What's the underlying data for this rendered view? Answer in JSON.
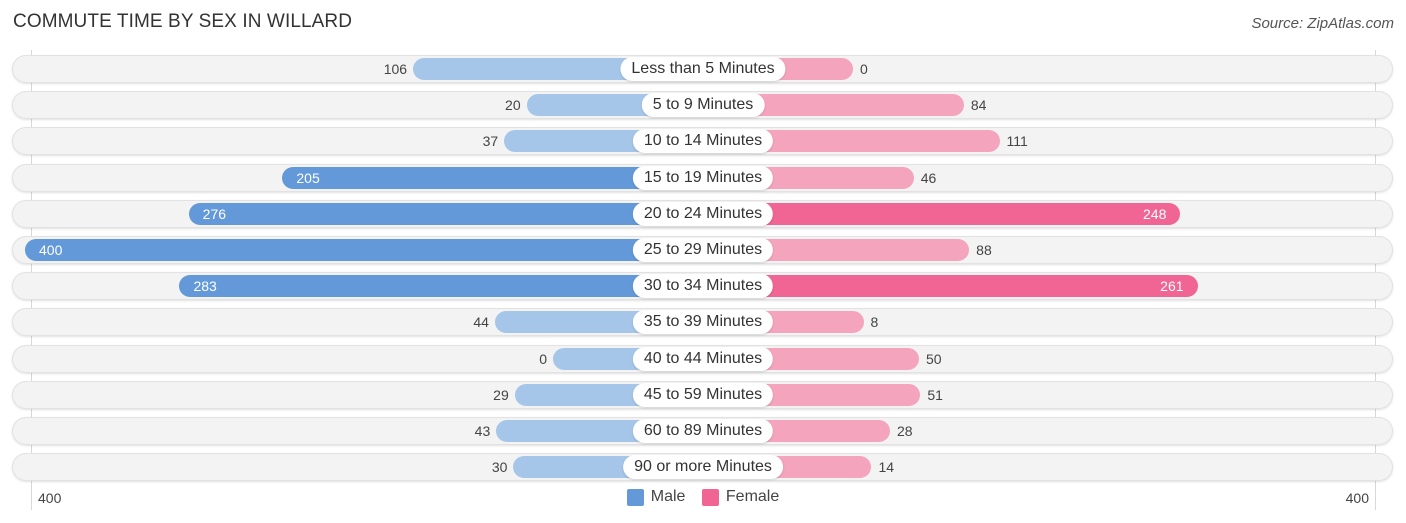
{
  "title": "COMMUTE TIME BY SEX IN WILLARD",
  "source": "Source: ZipAtlas.com",
  "colors": {
    "male_strong": "#6399d9",
    "male_light": "#a5c6e9",
    "female_strong": "#f06593",
    "female_light": "#f5a4bd"
  },
  "chart_data": {
    "type": "bar",
    "orientation": "horizontal-diverging",
    "title": "COMMUTE TIME BY SEX IN WILLARD",
    "categories": [
      "Less than 5 Minutes",
      "5 to 9 Minutes",
      "10 to 14 Minutes",
      "15 to 19 Minutes",
      "20 to 24 Minutes",
      "25 to 29 Minutes",
      "30 to 34 Minutes",
      "35 to 39 Minutes",
      "40 to 44 Minutes",
      "45 to 59 Minutes",
      "60 to 89 Minutes",
      "90 or more Minutes"
    ],
    "series": [
      {
        "name": "Male",
        "values": [
          106,
          20,
          37,
          205,
          276,
          400,
          283,
          44,
          0,
          29,
          43,
          30
        ]
      },
      {
        "name": "Female",
        "values": [
          0,
          84,
          111,
          46,
          248,
          88,
          261,
          8,
          50,
          51,
          28,
          14
        ]
      }
    ],
    "axis": {
      "left_tick": "400",
      "right_tick": "400",
      "max": 400
    },
    "legend": {
      "position": "bottom-center",
      "items": [
        "Male",
        "Female"
      ]
    },
    "grid": false
  }
}
